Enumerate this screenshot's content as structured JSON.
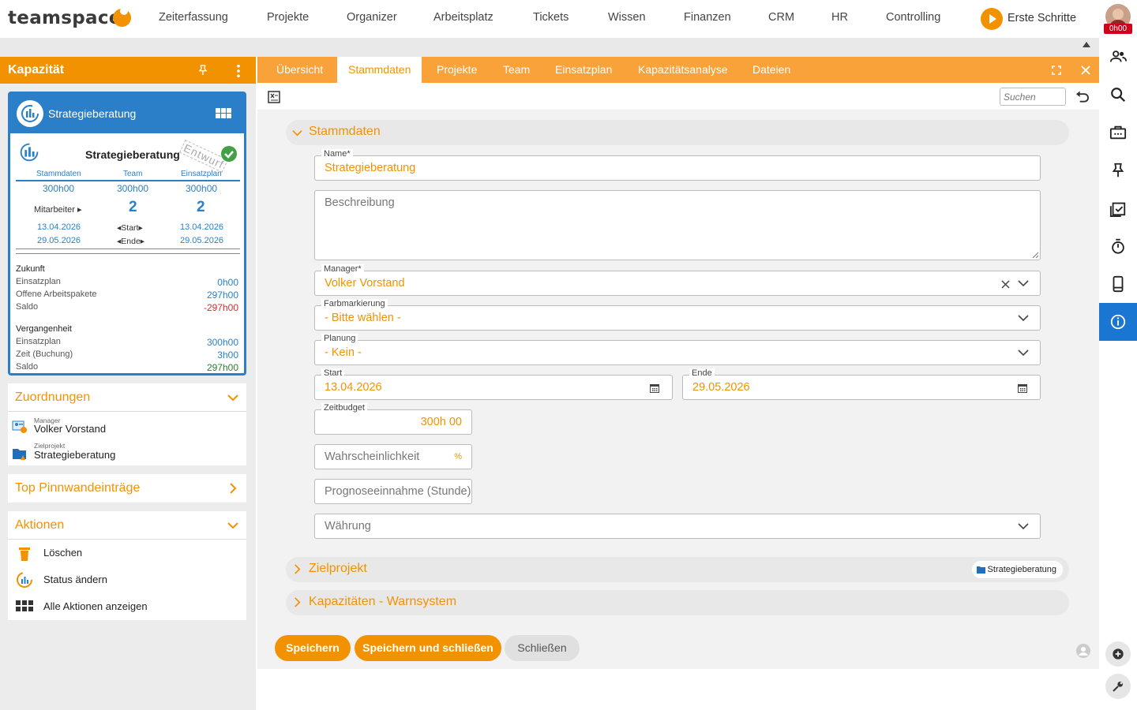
{
  "app": {
    "logo": "teamspace",
    "nav": [
      "Zeiterfassung",
      "Projekte",
      "Organizer",
      "Arbeitsplatz",
      "Tickets",
      "Wissen",
      "Finanzen",
      "CRM",
      "HR",
      "Controlling"
    ],
    "erste_schritte": "Erste Schritte",
    "time_badge": "0h00"
  },
  "left": {
    "title": "Kapazität",
    "card": {
      "title": "Strategieberatung",
      "subtitle": "Strategieberatung",
      "stamp": "Entwurf",
      "cols": [
        "Stammdaten",
        "Team",
        "Einsatzplan"
      ],
      "hours": [
        "300h00",
        "300h00",
        "300h00"
      ],
      "mitarbeiter_label": "Mitarbeiter ▸",
      "team_count": "2",
      "plan_count": "2",
      "start_label": "◂Start▸",
      "end_label": "◂Ende▸",
      "start_left": "13.04.2026",
      "end_left": "29.05.2026",
      "start_right": "13.04.2026",
      "end_right": "29.05.2026",
      "future_title": "Zukunft",
      "future": [
        {
          "label": "Einsatzplan",
          "value": "0h00"
        },
        {
          "label": "Offene Arbeitspakete",
          "value": "297h00"
        },
        {
          "label": "Saldo",
          "value": "-297h00"
        }
      ],
      "past_title": "Vergangenheit",
      "past": [
        {
          "label": "Einsatzplan",
          "value": "300h00"
        },
        {
          "label": "Zeit (Buchung)",
          "value": "3h00"
        },
        {
          "label": "Saldo",
          "value": "297h00"
        }
      ]
    },
    "zuordnungen": {
      "title": "Zuordnungen",
      "manager_label": "Manager",
      "manager": "Volker Vorstand",
      "project_label": "Zielprojekt",
      "project": "Strategieberatung"
    },
    "pinnwand": {
      "title": "Top Pinnwandeinträge"
    },
    "aktionen": {
      "title": "Aktionen",
      "items": [
        "Löschen",
        "Status ändern",
        "Alle Aktionen anzeigen"
      ]
    }
  },
  "tabs": [
    "Übersicht",
    "Stammdaten",
    "Projekte",
    "Team",
    "Einsatzplan",
    "Kapazitätsanalyse",
    "Dateien"
  ],
  "search_placeholder": "Suchen",
  "form": {
    "section": "Stammdaten",
    "name_label": "Name*",
    "name": "Strategieberatung",
    "beschreibung": "Beschreibung",
    "manager_label": "Manager*",
    "manager": "Volker Vorstand",
    "farb_label": "Farbmarkierung",
    "farb": "- Bitte wählen -",
    "planung_label": "Planung",
    "planung": "- Kein -",
    "start_label": "Start",
    "start": "13.04.2026",
    "ende_label": "Ende",
    "ende": "29.05.2026",
    "budget_label": "Zeitbudget",
    "budget": "300h 00",
    "wahrscheinlichkeit": "Wahrscheinlichkeit",
    "percent": "%",
    "prognose": "Prognoseeinnahme (Stunde)",
    "waehrung": "Währung",
    "zielprojekt": "Zielprojekt",
    "ziel_chip": "Strategieberatung",
    "warnsystem": "Kapazitäten - Warnsystem"
  },
  "buttons": {
    "save": "Speichern",
    "save_close": "Speichern und schließen",
    "close": "Schließen"
  },
  "colors": {
    "accent": "#f39200",
    "blue": "#2b7fc9",
    "active_icon_bg": "#1976d2"
  }
}
